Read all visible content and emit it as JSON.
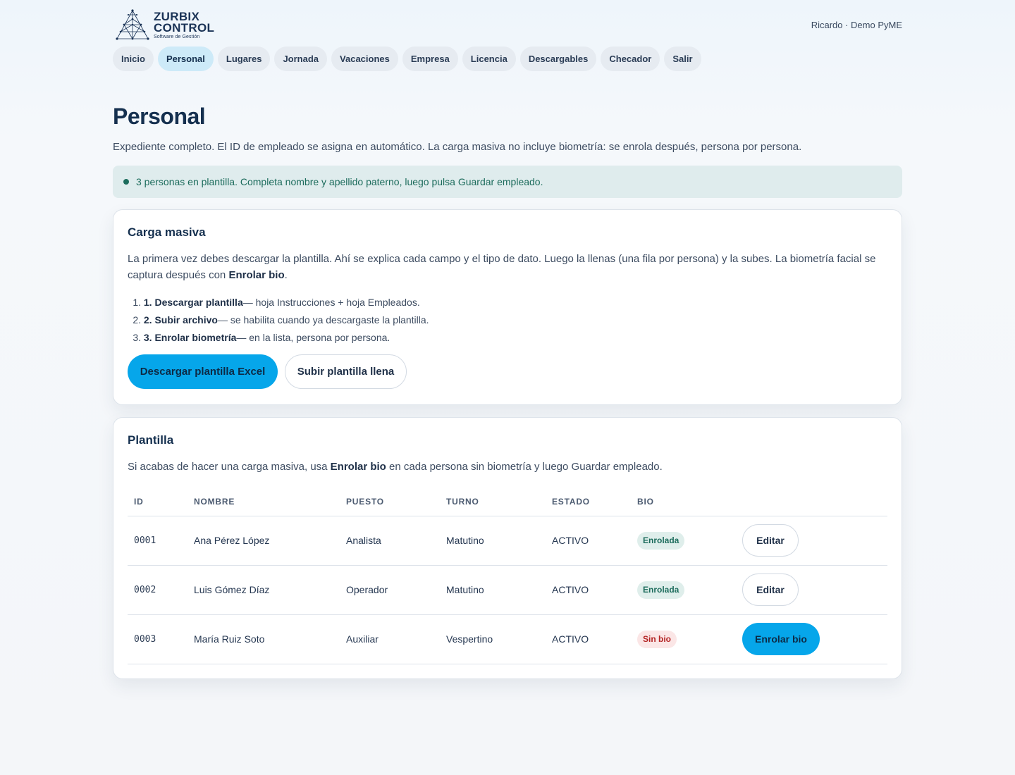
{
  "brand": {
    "name_line1": "ZURBIX",
    "name_line2": "CONTROL",
    "tagline": "Software de Gestión"
  },
  "user": {
    "label": "Ricardo · Demo PyME"
  },
  "nav": [
    {
      "label": "Inicio",
      "active": false
    },
    {
      "label": "Personal",
      "active": true
    },
    {
      "label": "Lugares",
      "active": false
    },
    {
      "label": "Jornada",
      "active": false
    },
    {
      "label": "Vacaciones",
      "active": false
    },
    {
      "label": "Empresa",
      "active": false
    },
    {
      "label": "Licencia",
      "active": false
    },
    {
      "label": "Descargables",
      "active": false
    },
    {
      "label": "Checador",
      "active": false
    },
    {
      "label": "Salir",
      "active": false
    }
  ],
  "page": {
    "title": "Personal",
    "subtitle": "Expediente completo. El ID de empleado se asigna en automático. La carga masiva no incluye biometría: se enrola después, persona por persona.",
    "notice": "3 personas en plantilla. Completa nombre y apellido paterno, luego pulsa Guardar empleado."
  },
  "bulk": {
    "title": "Carga masiva",
    "desc_part1": "La primera vez debes descargar la plantilla. Ahí se explica cada campo y el tipo de dato. Luego la llenas (una fila por persona) y la subes. La biometría facial se captura después con ",
    "desc_bold": "Enrolar bio",
    "desc_part2": ".",
    "steps": [
      {
        "num": "1.",
        "title": "1. Descargar plantilla",
        "text": " — hoja Instrucciones + hoja Empleados."
      },
      {
        "num": "2.",
        "title": "2. Subir archivo",
        "text": " — se habilita cuando ya descargaste la plantilla."
      },
      {
        "num": "3.",
        "title": "3. Enrolar biometría",
        "text": " — en la lista, persona por persona."
      }
    ],
    "download_label": "Descargar plantilla Excel",
    "upload_label": "Subir plantilla llena"
  },
  "staff": {
    "title": "Plantilla",
    "desc_part1": "Si acabas de hacer una carga masiva, usa ",
    "desc_bold": "Enrolar bio",
    "desc_part2": " en cada persona sin biometría y luego Guardar empleado.",
    "columns": [
      "ID",
      "NOMBRE",
      "PUESTO",
      "TURNO",
      "ESTADO",
      "BIO",
      ""
    ],
    "rows": [
      {
        "id": "0001",
        "name": "Ana Pérez López",
        "role": "Analista",
        "shift": "Matutino",
        "status": "ACTIVO",
        "bio": "Enrolada",
        "bio_ok": true,
        "action": "Editar"
      },
      {
        "id": "0002",
        "name": "Luis Gómez Díaz",
        "role": "Operador",
        "shift": "Matutino",
        "status": "ACTIVO",
        "bio": "Enrolada",
        "bio_ok": true,
        "action": "Editar"
      },
      {
        "id": "0003",
        "name": "María Ruiz Soto",
        "role": "Auxiliar",
        "shift": "Vespertino",
        "status": "ACTIVO",
        "bio": "Sin bio",
        "bio_ok": false,
        "action": "Enrolar bio"
      }
    ]
  },
  "colors": {
    "accent": "#06a6ea",
    "navy": "#15304f",
    "success": "#1c6c5c",
    "danger": "#b42424"
  }
}
